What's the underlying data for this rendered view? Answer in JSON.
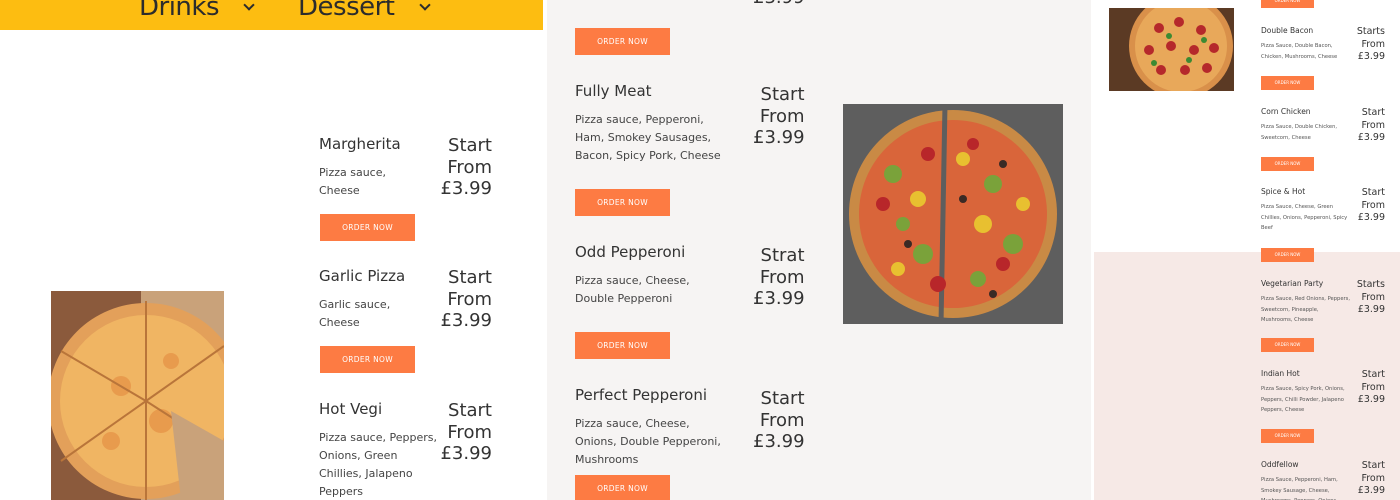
{
  "nav": {
    "items": [
      {
        "label": "Drinks"
      },
      {
        "label": "Dessert"
      }
    ]
  },
  "order_label": "ORDER NOW",
  "left_menu": [
    {
      "name": "Margherita",
      "desc": "Pizza sauce, Cheese",
      "price": "Start\nFrom\n£3.99"
    },
    {
      "name": "Garlic Pizza",
      "desc": "Garlic sauce, Cheese",
      "price": "Start\nFrom\n£3.99"
    },
    {
      "name": "Hot Vegi",
      "desc": "Pizza sauce, Peppers, Onions, Green Chillies, Jalapeno Peppers",
      "price": "Start\nFrom\n£3.99"
    }
  ],
  "mid_menu": [
    {
      "name": "Fully Meat",
      "desc": "Pizza sauce, Pepperoni, Ham, Smokey Sausages, Bacon, Spicy Pork, Cheese",
      "price": "Start\nFrom\n£3.99"
    },
    {
      "name": "Odd Pepperoni",
      "desc": "Pizza sauce, Cheese, Double Pepperoni",
      "price": "Strat\nFrom\n£3.99"
    },
    {
      "name": "Perfect Pepperoni",
      "desc": "Pizza sauce, Cheese, Onions, Double Pepperoni, Mushrooms",
      "price": "Start\nFrom\n£3.99"
    }
  ],
  "mid_partial_price": "£3.99",
  "right_menu": [
    {
      "name": "Double Bacon",
      "desc": "Pizza Sauce, Double Bacon, Chicken, Mushrooms, Cheese",
      "price": "Starts\nFrom\n£3.99"
    },
    {
      "name": "Corn Chicken",
      "desc": "Pizza Sauce, Double Chicken, Sweetcorn, Cheese",
      "price": "Start\nFrom\n£3.99"
    },
    {
      "name": "Spice & Hot",
      "desc": "Pizza Sauce, Cheese, Green Chillies, Onions, Pepperoni, Spicy Beef",
      "price": "Start\nFrom\n£3.99"
    },
    {
      "name": "Vegetarian Party",
      "desc": "Pizza Sauce, Red Onions, Peppers, Sweetcorn, Pineapple, Mushrooms, Cheese",
      "price": "Starts\nFrom\n£3.99"
    },
    {
      "name": "Indian Hot",
      "desc": "Pizza Sauce, Spicy Pork, Onions, Peppers, Chilli Powder, Jalapeno Peppers, Cheese",
      "price": "Start\nFrom\n£3.99"
    },
    {
      "name": "Oddfellow",
      "desc": "Pizza Sauce, Pepperoni, Ham, Smokey Sausage, Cheese, Mushrooms, Peppers, Onions",
      "price": "Start\nFrom\n£3.99"
    }
  ],
  "colors": {
    "nav_bar": "#fdbd11",
    "order_button": "#fd7b43",
    "mid_background": "#f6f4f3",
    "right_lower_background": "#f6e9e6"
  }
}
